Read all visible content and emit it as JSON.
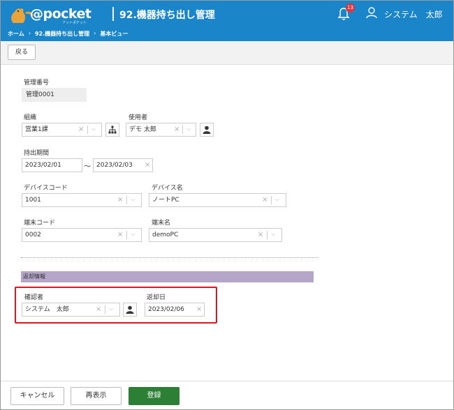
{
  "header": {
    "logo_text": "@pocket",
    "logo_sub": "アットポケット",
    "title": "92.機器持ち出し管理",
    "notification_count": "13",
    "user_name": "システム　太郎"
  },
  "breadcrumb": [
    "ホーム",
    "92.機器持ち出し管理",
    "基本ビュー"
  ],
  "toolbar": {
    "back_label": "戻る"
  },
  "form": {
    "management_no": {
      "label": "管理番号",
      "value": "管理0001"
    },
    "organization": {
      "label": "組織",
      "value": "営業1課"
    },
    "user": {
      "label": "使用者",
      "value": "デモ 太郎"
    },
    "period": {
      "label": "持出期間",
      "start": "2023/02/01",
      "tilde": "〜",
      "end": "2023/02/03"
    },
    "device_code": {
      "label": "デバイスコード",
      "value": "1001"
    },
    "device_name": {
      "label": "デバイス名",
      "value": "ノートPC"
    },
    "terminal_code": {
      "label": "端末コード",
      "value": "0002"
    },
    "terminal_name": {
      "label": "端末名",
      "value": "demoPC"
    }
  },
  "return_section": {
    "title": "返却情報",
    "confirmer": {
      "label": "確認者",
      "value": "システム　太郎"
    },
    "return_date": {
      "label": "返却日",
      "value": "2023/02/06"
    }
  },
  "footer": {
    "cancel_label": "キャンセル",
    "redisplay_label": "再表示",
    "register_label": "登録"
  },
  "colors": {
    "header": "#1a85c9",
    "primary": "#2c7f35",
    "section": "#b3a6c9",
    "highlight": "#e0141e"
  }
}
